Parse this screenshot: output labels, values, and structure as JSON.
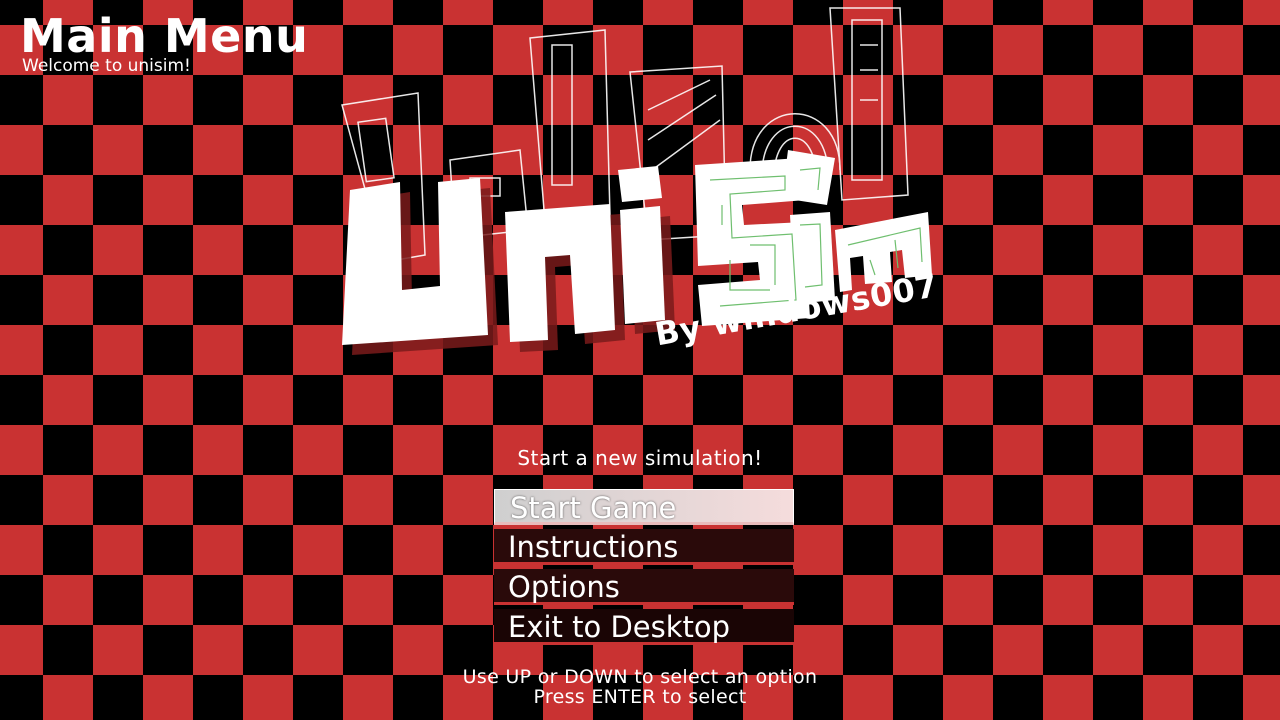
{
  "header": {
    "title": "Main Menu",
    "subtitle": "Welcome to unisim!"
  },
  "logo": {
    "name": "UniSim",
    "byline": "By windows007"
  },
  "menu": {
    "hint": "Start a new simulation!",
    "items": [
      {
        "label": "Start Game",
        "selected": true
      },
      {
        "label": "Instructions",
        "selected": false
      },
      {
        "label": "Options",
        "selected": false
      },
      {
        "label": "Exit to Desktop",
        "selected": false
      }
    ]
  },
  "controls": {
    "line1": "Use UP or DOWN to select an option",
    "line2": "Press ENTER to select"
  },
  "colors": {
    "checker_red": "#c93232",
    "checker_black": "#000000",
    "text": "#ffffff"
  }
}
